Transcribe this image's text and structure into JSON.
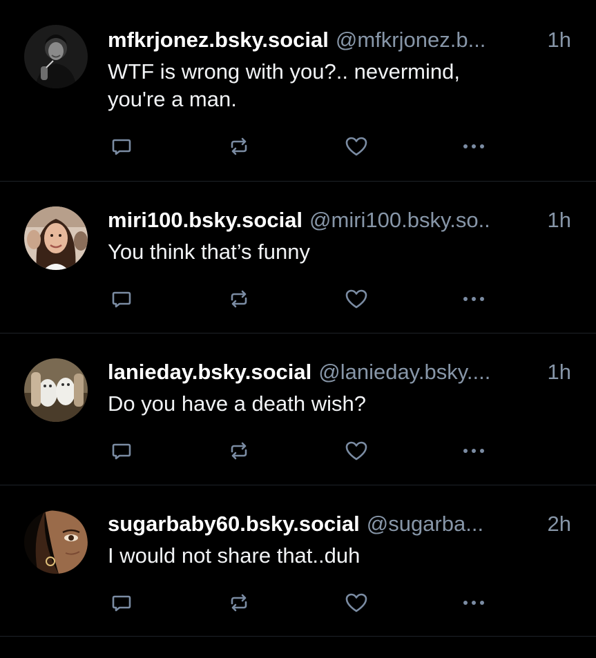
{
  "feed": {
    "posts": [
      {
        "display_name": "mfkrjonez.bsky.social",
        "handle": "@mfkrjonez.b...",
        "time": "1h",
        "text_lines": [
          "WTF is wrong with you?.. nevermind,",
          "you're a man."
        ]
      },
      {
        "display_name": "miri100.bsky.social",
        "handle": "@miri100.bsky.so..",
        "time": "1h",
        "text_lines": [
          "You think that’s funny"
        ]
      },
      {
        "display_name": "lanieday.bsky.social",
        "handle": "@lanieday.bsky....",
        "time": "1h",
        "text_lines": [
          "Do you have a death wish?"
        ]
      },
      {
        "display_name": "sugarbaby60.bsky.social",
        "handle": "@sugarba...",
        "time": "2h",
        "text_lines": [
          "I would not share that..duh"
        ]
      }
    ]
  },
  "icons": {
    "reply": "comment-bubble-icon",
    "repost": "repost-arrows-icon",
    "like": "heart-icon",
    "more": "ellipsis-icon"
  },
  "colors": {
    "background": "#000000",
    "text": "#ffffff",
    "secondary_text": "#8796a8",
    "divider": "#1e2329",
    "icon": "#7b8ca3"
  }
}
